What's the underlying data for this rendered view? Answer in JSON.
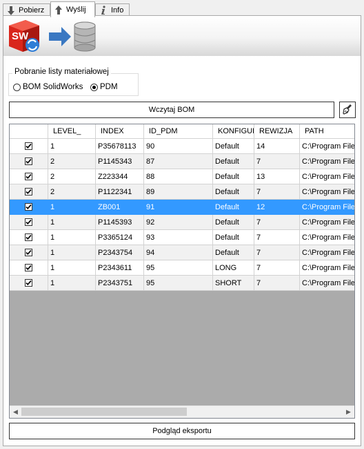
{
  "tabs": [
    {
      "label": "Pobierz",
      "icon": "arrow-down-icon"
    },
    {
      "label": "Wyślij",
      "icon": "arrow-up-icon"
    },
    {
      "label": "Info",
      "icon": "info-icon"
    }
  ],
  "group": {
    "title": "Pobranie listy materiałowej",
    "option_bom": "BOM SolidWorks",
    "option_pdm": "PDM",
    "selected": "PDM"
  },
  "load_button": "Wczytaj BOM",
  "preview_button": "Podgląd eksportu",
  "table": {
    "columns": [
      "",
      "LEVEL_",
      "INDEX",
      "ID_PDM",
      "KONFIGUR",
      "REWIZJA",
      "PATH"
    ],
    "rows": [
      {
        "checked": true,
        "level": "1",
        "index": "P35678113",
        "id_pdm": "90",
        "config": "Default",
        "rev": "14",
        "path": "C:\\Program File"
      },
      {
        "checked": true,
        "level": "2",
        "index": "P1145343",
        "id_pdm": "87",
        "config": "Default",
        "rev": "7",
        "path": "C:\\Program File"
      },
      {
        "checked": true,
        "level": "2",
        "index": "Z223344",
        "id_pdm": "88",
        "config": "Default",
        "rev": "13",
        "path": "C:\\Program File"
      },
      {
        "checked": true,
        "level": "2",
        "index": "P1122341",
        "id_pdm": "89",
        "config": "Default",
        "rev": "7",
        "path": "C:\\Program File"
      },
      {
        "checked": true,
        "level": "1",
        "index": "ZB001",
        "id_pdm": "91",
        "config": "Default",
        "rev": "12",
        "path": "C:\\Program File"
      },
      {
        "checked": true,
        "level": "1",
        "index": "P1145393",
        "id_pdm": "92",
        "config": "Default",
        "rev": "7",
        "path": "C:\\Program File"
      },
      {
        "checked": true,
        "level": "1",
        "index": "P3365124",
        "id_pdm": "93",
        "config": "Default",
        "rev": "7",
        "path": "C:\\Program File"
      },
      {
        "checked": true,
        "level": "1",
        "index": "P2343754",
        "id_pdm": "94",
        "config": "Default",
        "rev": "7",
        "path": "C:\\Program File"
      },
      {
        "checked": true,
        "level": "1",
        "index": "P2343611",
        "id_pdm": "95",
        "config": "LONG",
        "rev": "7",
        "path": "C:\\Program File"
      },
      {
        "checked": true,
        "level": "1",
        "index": "P2343751",
        "id_pdm": "95",
        "config": "SHORT",
        "rev": "7",
        "path": "C:\\Program File"
      }
    ],
    "selected_row": 4
  },
  "colors": {
    "selection": "#3399ff",
    "grid_empty": "#ababab"
  }
}
